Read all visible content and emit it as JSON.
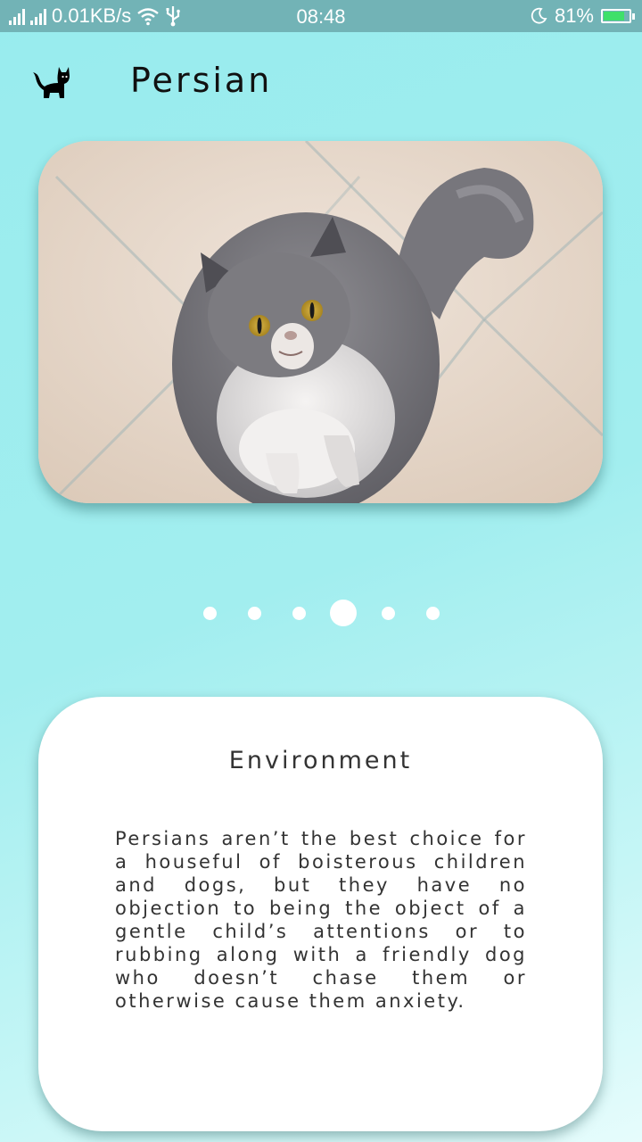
{
  "status_bar": {
    "network_speed": "0.01KB/s",
    "time": "08:48",
    "battery_percent": "81%",
    "battery_level": 0.81,
    "icons": [
      "signal-icon",
      "signal-icon",
      "wifi-icon",
      "usb-icon",
      "moon-icon",
      "battery-charging-icon"
    ]
  },
  "header": {
    "title": "Persian",
    "icon": "cat-icon"
  },
  "carousel": {
    "page_count": 6,
    "active_index": 3,
    "image_subject": "grey and white Persian cat on tiled floor"
  },
  "info_card": {
    "heading": "Environment",
    "body": "Persians aren’t the best choice for a houseful of boisterous children and dogs, but they have no objection to being the object of a gentle child’s attentions or to rubbing along with a friendly dog who doesn’t chase them or otherwise cause them anxiety."
  },
  "colors": {
    "status_bar": "#72b3b6",
    "background_top": "#98ecee",
    "background_bottom": "#e6fcfc",
    "card": "#ffffff",
    "battery_fill": "#3fe06a"
  }
}
